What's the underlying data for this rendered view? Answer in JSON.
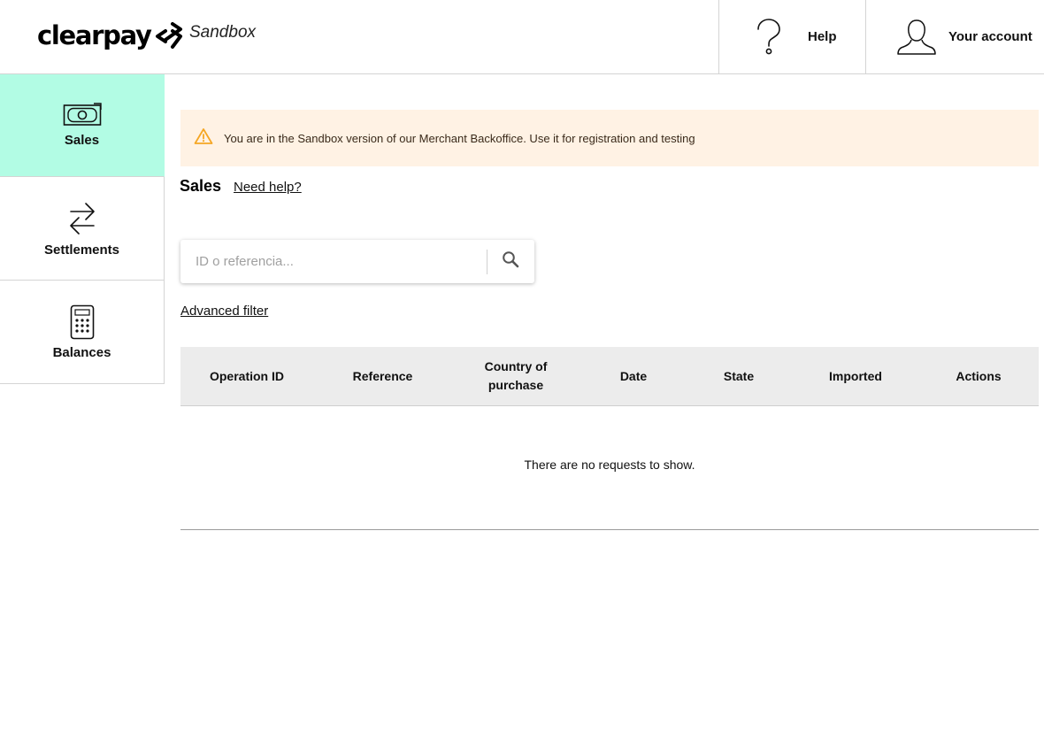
{
  "header": {
    "logo_text": "clearpay",
    "environment": "Sandbox",
    "help_label": "Help",
    "account_label": "Your account"
  },
  "sidebar": {
    "items": [
      {
        "label": "Sales",
        "icon": "banknote-icon",
        "active": true
      },
      {
        "label": "Settlements",
        "icon": "transfer-arrows-icon",
        "active": false
      },
      {
        "label": "Balances",
        "icon": "calculator-icon",
        "active": false
      }
    ]
  },
  "banner": {
    "icon": "warning-icon",
    "text": "You are in the Sandbox version of our Merchant Backoffice. Use it for registration and testing",
    "color": "#fff2e4"
  },
  "main": {
    "title": "Sales",
    "need_help_label": "Need help?",
    "search": {
      "placeholder": "ID o referencia...",
      "value": ""
    },
    "advanced_filter_label": "Advanced filter"
  },
  "table": {
    "columns": [
      "Operation ID",
      "Reference",
      "Country of purchase",
      "Date",
      "State",
      "Imported",
      "Actions"
    ],
    "rows": [],
    "empty_message": "There are no requests to show."
  },
  "colors": {
    "accent": "#b2fce4",
    "banner_bg": "#fff2e4",
    "warning": "#f5a623"
  }
}
